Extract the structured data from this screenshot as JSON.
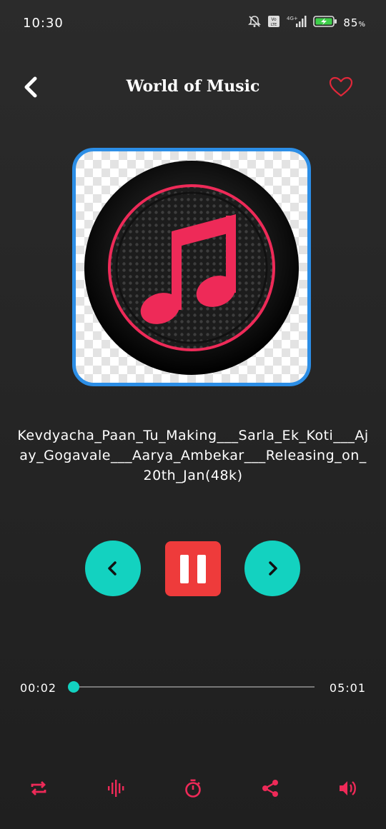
{
  "status_bar": {
    "time": "10:30",
    "battery_percent": "85",
    "battery_sign": "%",
    "network": "4G+",
    "icons": [
      "mute-icon",
      "volte-icon",
      "signal-icon",
      "battery-charging-icon"
    ]
  },
  "header": {
    "title": "World of Music",
    "back_icon": "chevron-left-icon",
    "favorite_icon": "heart-outline-icon"
  },
  "album_art": {
    "icon": "music-note-icon",
    "colors": {
      "border": "#2c8ee6",
      "note": "#ee2a58",
      "disc": "#111111"
    }
  },
  "song": {
    "title": "Kevdyacha_Paan_Tu_Making___Sarla_Ek_Koti___Ajay_Gogavale___Aarya_Ambekar___Releasing_on_20th_Jan(48k)"
  },
  "controls": {
    "previous_icon": "chevron-left-icon",
    "pause_icon": "pause-icon",
    "next_icon": "chevron-right-icon",
    "colors": {
      "nav": "#13d2c0",
      "pause": "#ee3b3b"
    }
  },
  "progress": {
    "elapsed": "00:02",
    "duration": "05:01",
    "fraction": 0.007
  },
  "bottom_bar": {
    "icons": [
      "repeat-icon",
      "equalizer-icon",
      "timer-icon",
      "share-icon",
      "volume-icon"
    ],
    "color": "#ee2a58"
  }
}
